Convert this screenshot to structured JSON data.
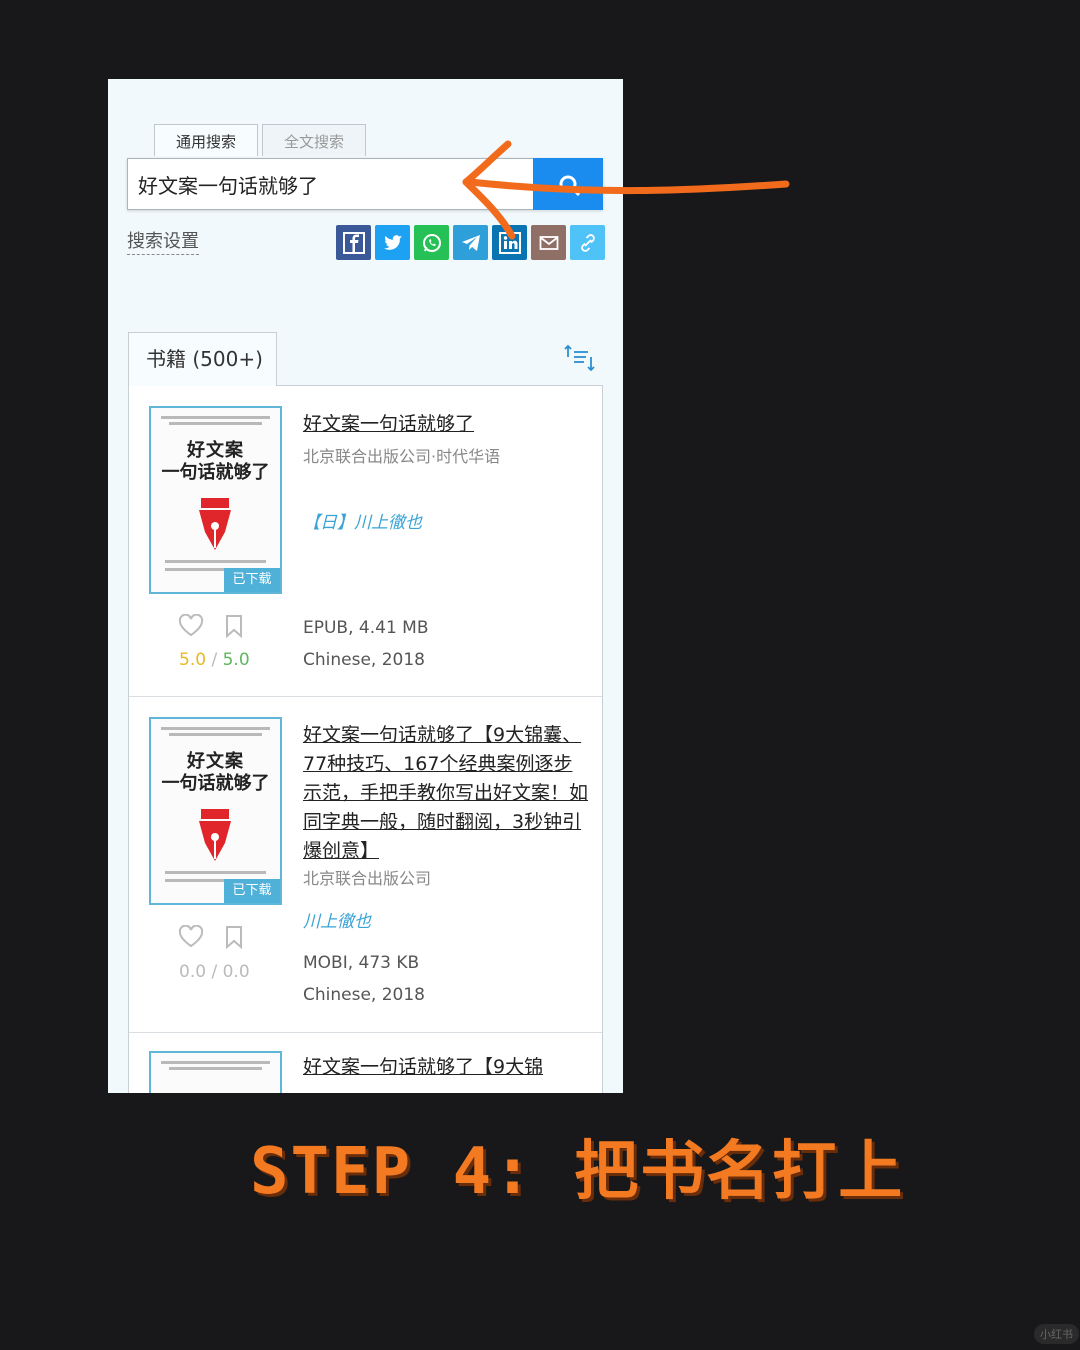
{
  "search": {
    "tab_general": "通用搜索",
    "tab_fulltext": "全文搜索",
    "query": "好文案一句话就够了",
    "settings_label": "搜索设置"
  },
  "share_icons": [
    "facebook-icon",
    "twitter-icon",
    "whatsapp-icon",
    "telegram-icon",
    "linkedin-icon",
    "email-icon",
    "link-icon"
  ],
  "results": {
    "tab_label": "书籍 (500+)",
    "items": [
      {
        "cover_title1": "好文案",
        "cover_title2": "一句话就够了",
        "badge": "已下载",
        "title": "好文案一句话就够了",
        "publisher": "北京联合出版公司·时代华语",
        "author": "【日】川上徹也",
        "rating_a": "5.0",
        "rating_sep": "/",
        "rating_b": "5.0",
        "format": "EPUB, 4.41 MB",
        "lang_year": "Chinese, 2018"
      },
      {
        "cover_title1": "好文案",
        "cover_title2": "一句话就够了",
        "badge": "已下载",
        "title": "好文案一句话就够了【9大锦囊、77种技巧、167个经典案例逐步示范，手把手教你写出好文案！如同字典一般，随时翻阅，3秒钟引爆创意】",
        "publisher": "北京联合出版公司",
        "author": "川上徹也",
        "rating_a": "0.0",
        "rating_sep": "/",
        "rating_b": "0.0",
        "format": "MOBI, 473 KB",
        "lang_year": "Chinese, 2018"
      },
      {
        "title": "好文案一句话就够了【9大锦"
      }
    ]
  },
  "caption": "STEP 4: 把书名打上",
  "watermark": "小红书",
  "colors": {
    "accent_blue": "#1a8cf0",
    "arrow_orange": "#f26b1d",
    "caption_orange": "#f47a21",
    "rating_gold": "#e8b923",
    "rating_green": "#5cb85c"
  }
}
